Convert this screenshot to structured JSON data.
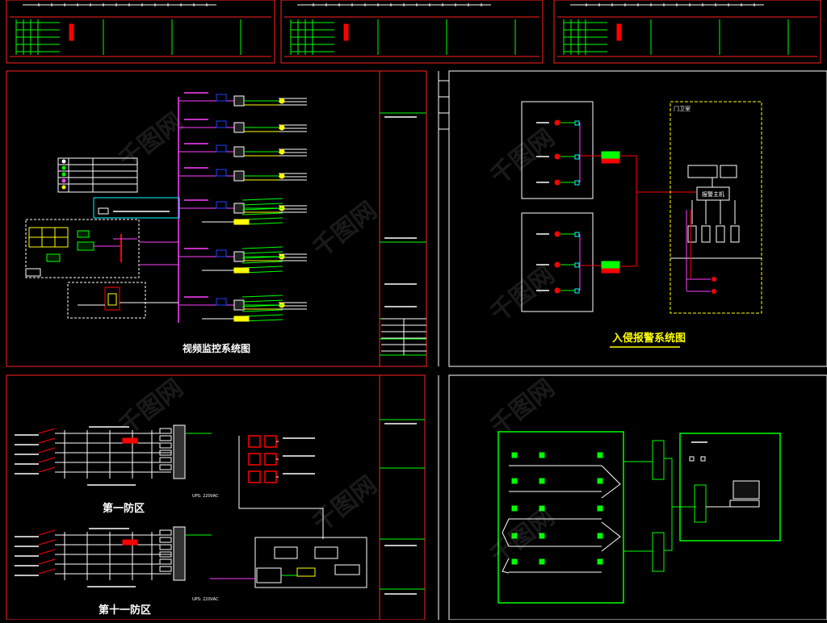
{
  "watermark": "千图网",
  "panels": {
    "video": {
      "title": "视频监控系统图"
    },
    "alarm": {
      "title": "入侵报警系统图",
      "guard_room": "门卫室",
      "alarm_host": "报警主机"
    },
    "fence": {
      "zone1": "第一防区",
      "zone11": "第十一防区",
      "voltage1": "UPS: 220VAC",
      "voltage2": "UPS: 220VAC"
    }
  },
  "colors": {
    "bg": "#000000",
    "frame": "#ff2020",
    "green": "#00ff00",
    "yellow": "#ffff00",
    "magenta": "#ff40ff",
    "white": "#ffffff",
    "red": "#ff0000",
    "cyan": "#00ffff",
    "blue": "#2040ff"
  }
}
